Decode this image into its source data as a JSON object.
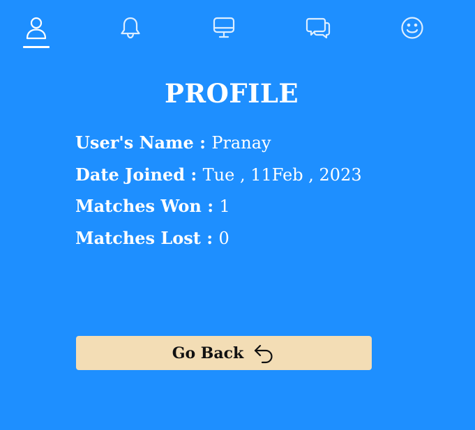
{
  "nav": {
    "items": [
      {
        "icon": "user-icon",
        "active": true
      },
      {
        "icon": "bell-icon",
        "active": false
      },
      {
        "icon": "monitor-icon",
        "active": false
      },
      {
        "icon": "chat-icon",
        "active": false
      },
      {
        "icon": "smiley-icon",
        "active": false
      }
    ]
  },
  "profile": {
    "title": "PROFILE",
    "separator": " : ",
    "name_label": "User's Name",
    "name_value": "Pranay",
    "joined_label": "Date Joined",
    "joined_value": "Tue , 11Feb , 2023",
    "won_label": "Matches Won",
    "won_value": "1",
    "lost_label": "Matches Lost",
    "lost_value": "0"
  },
  "actions": {
    "go_back_label": "Go Back",
    "go_back_icon": "undo-arrow-icon"
  },
  "colors": {
    "background": "#1e8fff",
    "text": "#ffffff",
    "button_bg": "#f3ddb5",
    "button_text": "#111111"
  }
}
